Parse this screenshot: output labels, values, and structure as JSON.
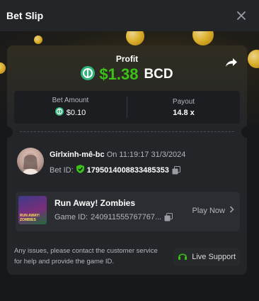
{
  "header": {
    "title": "Bet Slip"
  },
  "profit": {
    "label": "Profit",
    "value": "$1.38",
    "currency": "BCD"
  },
  "bet_amount": {
    "label": "Bet Amount",
    "value": "$0.10"
  },
  "payout": {
    "label": "Payout",
    "value": "14.8 x"
  },
  "user": {
    "name": "Girlxinh-mê-bc",
    "on_text": "On 11:19:17 31/3/2024",
    "bet_id_label": "Bet ID:",
    "bet_id": "1795014008833485353"
  },
  "game": {
    "title": "Run Away! Zombies",
    "id_label": "Game ID:",
    "id": "240911555767767...",
    "thumb_text": "RUN AWAY! ZOMBIES",
    "play_label": "Play Now"
  },
  "footer": {
    "text": "Any issues, please contact the customer service for help and provide the game ID.",
    "support_label": "Live Support"
  },
  "colors": {
    "accent_green": "#3bc117",
    "background": "#17181b",
    "card": "#232529",
    "coin_gold": "#f2c230"
  },
  "icons": [
    "close-icon",
    "share-icon",
    "bcd-coin-icon",
    "verified-shield-icon",
    "copy-icon",
    "chevron-right-icon",
    "headset-icon"
  ]
}
